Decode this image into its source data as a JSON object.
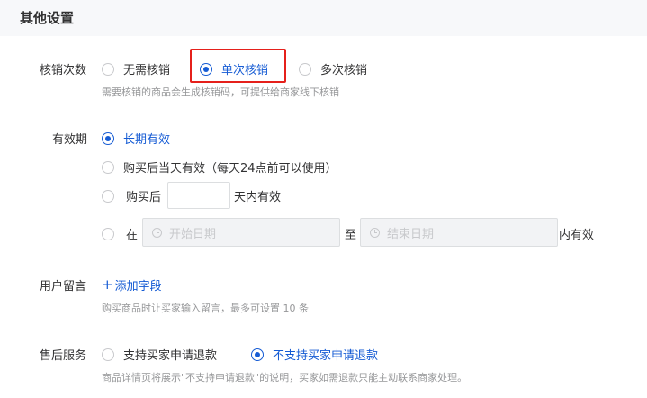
{
  "section": {
    "title": "其他设置"
  },
  "verify": {
    "label": "核销次数",
    "options": [
      "无需核销",
      "单次核销",
      "多次核销"
    ],
    "selected": 1,
    "hint": "需要核销的商品会生成核销码，可提供给商家线下核销"
  },
  "validity": {
    "label": "有效期",
    "option_long": "长期有效",
    "option_same_day": "购买后当天有效（每天24点前可以使用）",
    "option_after_prefix": "购买后",
    "option_after_suffix": "天内有效",
    "option_range_prefix": "在",
    "start_placeholder": "开始日期",
    "range_to": "至",
    "end_placeholder": "结束日期",
    "option_range_suffix": "内有效"
  },
  "message": {
    "label": "用户留言",
    "add_plus": "+",
    "add_label": "添加字段",
    "hint": "购买商品时让买家输入留言，最多可设置 10 条"
  },
  "aftersale": {
    "label": "售后服务",
    "options": [
      "支持买家申请退款",
      "不支持买家申请退款"
    ],
    "selected": 1,
    "hint": "商品详情页将展示\"不支持申请退款\"的说明，买家如需退款只能主动联系商家处理。"
  },
  "colors": {
    "accent": "#155bd4",
    "highlight": "#e5201b",
    "hint": "#969799"
  }
}
